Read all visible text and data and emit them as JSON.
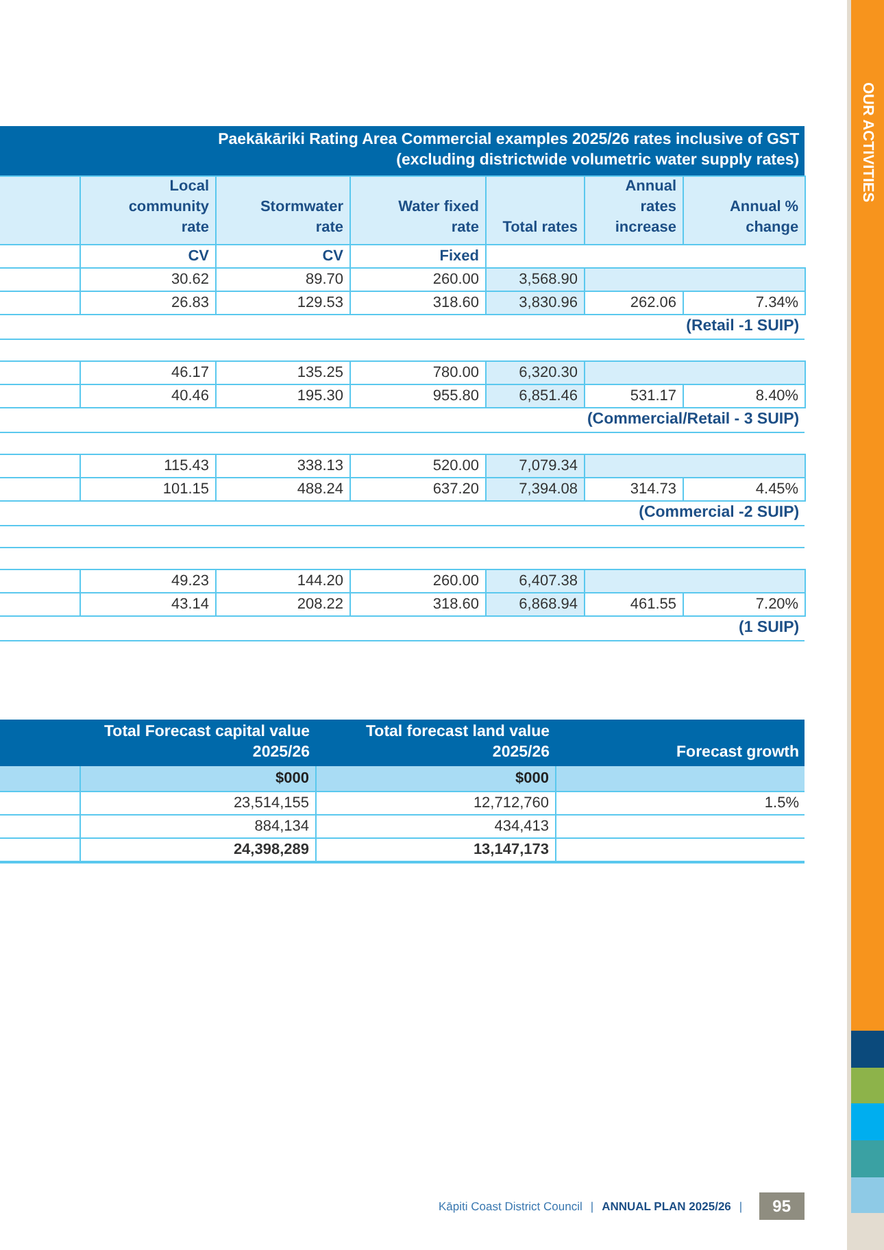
{
  "rates_table": {
    "title_lines": [
      "Paekākāriki Rating Area Commercial examples 2025/26 rates inclusive of GST",
      "(excluding districtwide volumetric water supply rates)"
    ],
    "columns": [
      "Local community\nrate",
      "Stormwater\nrate",
      "Water fixed\nrate",
      "Total rates",
      "Annual\nrates\nincrease",
      "Annual %\nchange"
    ],
    "units": [
      "CV",
      "CV",
      "Fixed"
    ],
    "rows": [
      {
        "kind": "values",
        "cells": [
          "30.62",
          "89.70",
          "260.00",
          "3,568.90"
        ]
      },
      {
        "kind": "values",
        "cells": [
          "26.83",
          "129.53",
          "318.60",
          "3,830.96",
          "262.06",
          "7.34%"
        ]
      },
      {
        "kind": "note",
        "text": "(Retail -1 SUIP)"
      },
      {
        "kind": "blank"
      },
      {
        "kind": "values",
        "cells": [
          "46.17",
          "135.25",
          "780.00",
          "6,320.30"
        ]
      },
      {
        "kind": "values",
        "cells": [
          "40.46",
          "195.30",
          "955.80",
          "6,851.46",
          "531.17",
          "8.40%"
        ]
      },
      {
        "kind": "note",
        "text": "(Commercial/Retail - 3 SUIP)"
      },
      {
        "kind": "blank"
      },
      {
        "kind": "values",
        "cells": [
          "115.43",
          "338.13",
          "520.00",
          "7,079.34"
        ]
      },
      {
        "kind": "values",
        "cells": [
          "101.15",
          "488.24",
          "637.20",
          "7,394.08",
          "314.73",
          "4.45%"
        ]
      },
      {
        "kind": "note",
        "text": "(Commercial -2 SUIP)"
      },
      {
        "kind": "blank"
      },
      {
        "kind": "blank"
      },
      {
        "kind": "values",
        "cells": [
          "49.23",
          "144.20",
          "260.00",
          "6,407.38"
        ]
      },
      {
        "kind": "values",
        "cells": [
          "43.14",
          "208.22",
          "318.60",
          "6,868.94",
          "461.55",
          "7.20%"
        ]
      },
      {
        "kind": "note",
        "text": "(1 SUIP)"
      }
    ]
  },
  "forecast_table": {
    "columns": [
      "Total Forecast capital value\n2025/26",
      "Total forecast land value\n2025/26",
      "Forecast growth"
    ],
    "units": [
      "$000",
      "$000"
    ],
    "rows": [
      {
        "cells": [
          "23,514,155",
          "12,712,760",
          "1.5%"
        ],
        "bold": false
      },
      {
        "cells": [
          "884,134",
          "434,413"
        ],
        "bold": false
      },
      {
        "cells": [
          "24,398,289",
          "13,147,173"
        ],
        "bold": true
      }
    ]
  },
  "side_tab": {
    "label": "OUR ACTIVITIES"
  },
  "side_blocks": [
    {
      "color": "#0b4a7c"
    },
    {
      "color": "#8db34a"
    },
    {
      "color": "#00aeef"
    },
    {
      "color": "#3aa1a3"
    },
    {
      "color": "#8ecae6"
    },
    {
      "color": "#e3dcd0"
    }
  ],
  "footer": {
    "organisation": "Kāpiti Coast District Council",
    "separator_1": "|",
    "document": "ANNUAL PLAN 2025/26",
    "separator_2": "|",
    "page_number": "95"
  }
}
